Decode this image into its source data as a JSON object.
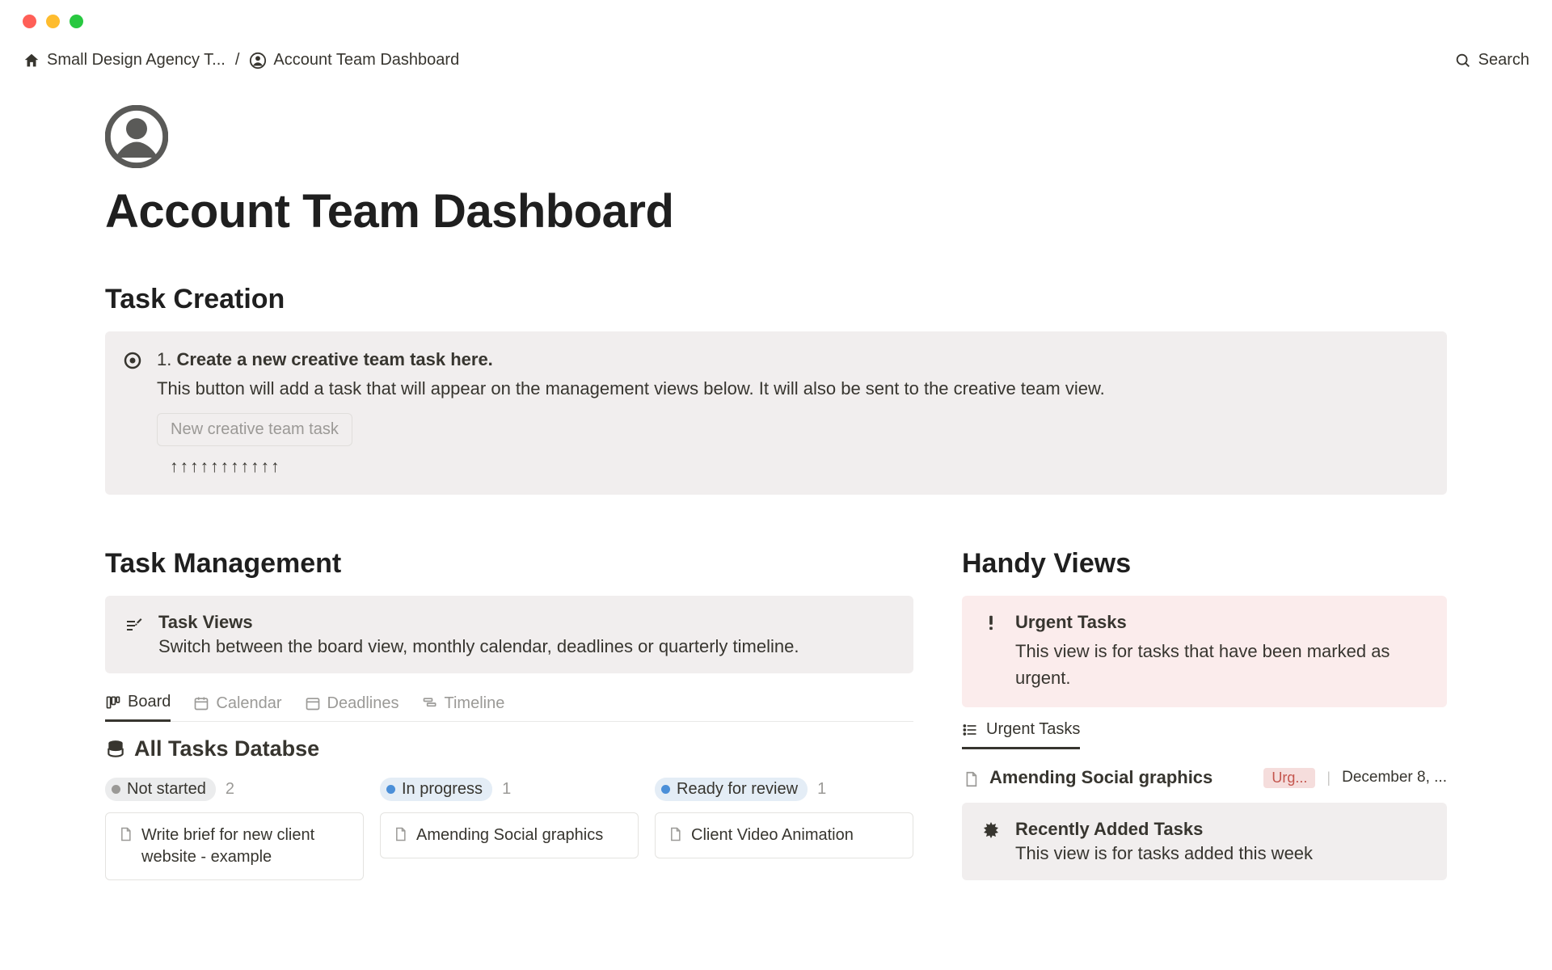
{
  "breadcrumb": {
    "root": "Small Design Agency T...",
    "current": "Account Team Dashboard"
  },
  "search_label": "Search",
  "page_title": "Account Team Dashboard",
  "task_creation": {
    "heading": "Task Creation",
    "callout_prefix": "1. ",
    "callout_title": "Create a new creative team task here.",
    "callout_desc": "This button will add a task that will appear on the management views below. It will also be sent to the creative team view.",
    "button_label": "New creative team task",
    "arrows": "↑↑↑↑↑↑↑↑↑↑↑"
  },
  "task_management": {
    "heading": "Task Management",
    "views_title": "Task Views",
    "views_desc": "Switch between the board view, monthly calendar, deadlines or quarterly timeline.",
    "tabs": {
      "board": "Board",
      "calendar": "Calendar",
      "deadlines": "Deadlines",
      "timeline": "Timeline"
    },
    "db_title": "All Tasks Databse",
    "columns": [
      {
        "status": "Not started",
        "count": "2",
        "card": "Write brief for new client website - example"
      },
      {
        "status": "In progress",
        "count": "1",
        "card": "Amending Social graphics"
      },
      {
        "status": "Ready for review",
        "count": "1",
        "card": "Client Video Animation"
      }
    ]
  },
  "handy_views": {
    "heading": "Handy Views",
    "urgent_title": "Urgent Tasks",
    "urgent_desc": "This view is for tasks that have been marked as urgent.",
    "urgent_tab": "Urgent Tasks",
    "task": {
      "name": "Amending Social graphics",
      "badge": "Urg...",
      "pipe": "|",
      "date": "December 8, ..."
    },
    "recent_title": "Recently Added Tasks",
    "recent_desc": "This view is for tasks added this week"
  }
}
